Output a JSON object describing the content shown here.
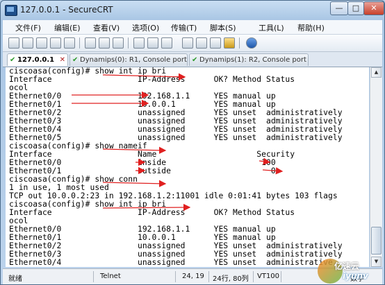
{
  "window": {
    "title": "127.0.0.1 - SecureCRT"
  },
  "controls": {
    "min": "—",
    "max": "□",
    "close": "✕"
  },
  "menu": [
    "文件(F)",
    "编辑(E)",
    "查看(V)",
    "选项(O)",
    "传输(T)",
    "脚本(S)",
    "工具(L)",
    "帮助(H)"
  ],
  "toolbar_icons": [
    "connect-icon",
    "quick-connect-icon",
    "new-session-icon",
    "reconnect-icon",
    "disconnect-icon",
    "copy-icon",
    "paste-icon",
    "find-icon",
    "print-icon",
    "session-options-icon",
    "global-options-icon",
    "sftp-icon",
    "keymap-icon",
    "lock-icon",
    "help-icon"
  ],
  "tabs": [
    {
      "label": "127.0.0.1",
      "active": true
    },
    {
      "label": "Dynamips(0): R1, Console port",
      "active": false
    },
    {
      "label": "Dynamips(1): R2, Console port",
      "active": false
    }
  ],
  "terminal": {
    "lines": [
      "ciscoasa(config)# show int ip bri",
      "Interface                  IP-Address      OK? Method Status",
      "ocol",
      "Ethernet0/0                192.168.1.1     YES manual up",
      "Ethernet0/1                10.0.0.1        YES manual up",
      "Ethernet0/2                unassigned      YES unset  administratively",
      "Ethernet0/3                unassigned      YES unset  administratively",
      "Ethernet0/4                unassigned      YES unset  administratively",
      "Ethernet0/5                unassigned      YES unset  administratively",
      "ciscoasa(config)# show nameif",
      "Interface                  Name                     Security",
      "Ethernet0/0                inside                    100",
      "Ethernet0/1                outside                     0",
      "ciscoasa(config)# show conn",
      "1 in use, 1 most used",
      "TCP out 10.0.0.2:23 in 192.168.1.2:11001 idle 0:01:41 bytes 103 flags",
      "ciscoasa(config)# show int ip bri",
      "Interface                  IP-Address      OK? Method Status",
      "ocol",
      "Ethernet0/0                192.168.1.1     YES manual up",
      "Ethernet0/1                10.0.0.1        YES manual up",
      "Ethernet0/2                unassigned      YES unset  administratively",
      "Ethernet0/3                unassigned      YES unset  administratively",
      "Ethernet0/4                unassigned      YES unset  administrative"
    ]
  },
  "annotation_color": "#e02020",
  "status": {
    "ready": "就绪",
    "protocol": "Telnet",
    "cursor": "24, 19",
    "size": "24行, 80列",
    "term": "VT100",
    "extra": "数字"
  },
  "watermark": {
    "text": "亿速云",
    "sub": "iyunv"
  }
}
